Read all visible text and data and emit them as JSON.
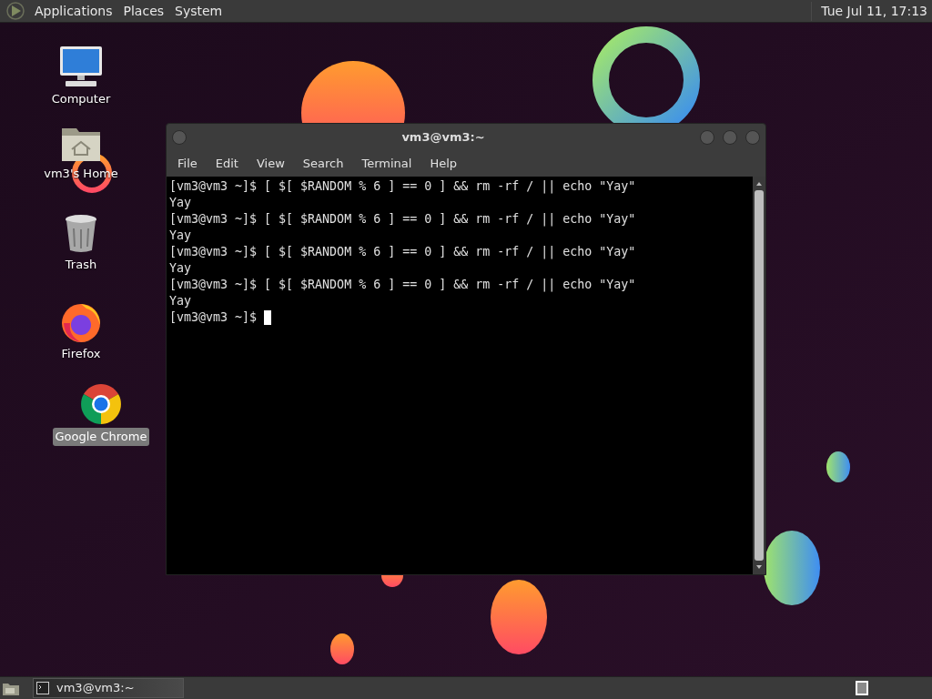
{
  "top_panel": {
    "menus": [
      "Applications",
      "Places",
      "System"
    ],
    "clock": "Tue Jul 11, 17:13"
  },
  "desktop_icons": [
    {
      "kind": "computer",
      "label": "Computer",
      "selected": false
    },
    {
      "kind": "home",
      "label": "vm3's Home",
      "selected": false
    },
    {
      "kind": "trash",
      "label": "Trash",
      "selected": false
    },
    {
      "kind": "firefox",
      "label": "Firefox",
      "selected": false
    },
    {
      "kind": "chrome",
      "label": "Google Chrome",
      "selected": true
    }
  ],
  "terminal": {
    "title": "vm3@vm3:~",
    "menu": [
      "File",
      "Edit",
      "View",
      "Search",
      "Terminal",
      "Help"
    ],
    "lines": [
      "[vm3@vm3 ~]$ [ $[ $RANDOM % 6 ] == 0 ] && rm -rf / || echo \"Yay\"",
      "Yay",
      "[vm3@vm3 ~]$ [ $[ $RANDOM % 6 ] == 0 ] && rm -rf / || echo \"Yay\"",
      "Yay",
      "[vm3@vm3 ~]$ [ $[ $RANDOM % 6 ] == 0 ] && rm -rf / || echo \"Yay\"",
      "Yay",
      "[vm3@vm3 ~]$ [ $[ $RANDOM % 6 ] == 0 ] && rm -rf / || echo \"Yay\"",
      "Yay"
    ],
    "prompt": "[vm3@vm3 ~]$ "
  },
  "taskbar_items": [
    {
      "label": "vm3@vm3:~"
    }
  ]
}
